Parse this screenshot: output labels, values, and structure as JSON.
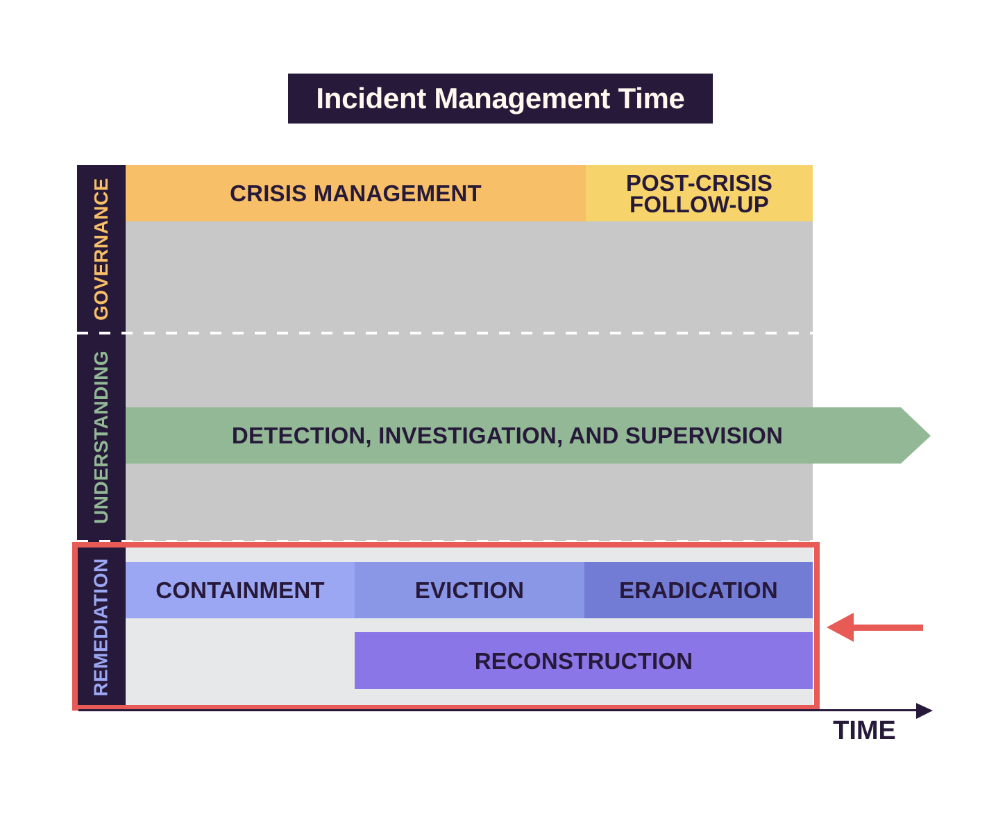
{
  "title": "Incident Management Time",
  "lanes": [
    {
      "id": "governance",
      "label": "GOVERNANCE",
      "label_color": "#f7bf67"
    },
    {
      "id": "understanding",
      "label": "UNDERSTANDING",
      "label_color": "#92b895"
    },
    {
      "id": "remediation",
      "label": "REMEDIATION",
      "label_color": "#9ca7f3"
    }
  ],
  "governance": {
    "crisis_management": {
      "label": "CRISIS MANAGEMENT",
      "color": "#f7bf67"
    },
    "post_crisis": {
      "label": "POST-CRISIS\nFOLLOW-UP",
      "color": "#f7d46b"
    }
  },
  "understanding": {
    "detection": {
      "label": "DETECTION, INVESTIGATION, AND SUPERVISION",
      "color": "#92b895"
    }
  },
  "remediation": {
    "containment": {
      "label": "CONTAINMENT",
      "color": "#9ca7f3"
    },
    "eviction": {
      "label": "EVICTION",
      "color": "#8a97e6"
    },
    "eradication": {
      "label": "ERADICATION",
      "color": "#737cd5"
    },
    "reconstruction": {
      "label": "RECONSTRUCTION",
      "color": "#8a76e6"
    }
  },
  "highlight": {
    "color": "#e85a55",
    "target": "remediation"
  },
  "axis": {
    "label": "TIME",
    "color": "#27193a"
  },
  "colors": {
    "dark": "#27193a",
    "grey_lane": "#c8c8c8",
    "remediation_bg": "#e7e8ea"
  }
}
